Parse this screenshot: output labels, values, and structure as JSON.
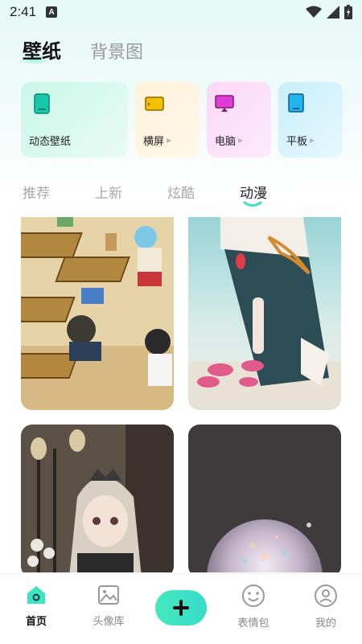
{
  "status_bar": {
    "time": "2:41",
    "notification_badge": "A"
  },
  "top_tabs": [
    {
      "label": "壁纸",
      "active": true
    },
    {
      "label": "背景图",
      "active": false
    }
  ],
  "categories": [
    {
      "label": "动态壁纸",
      "icon": "phone-icon",
      "color": "#17c9a8"
    },
    {
      "label": "横屏",
      "icon": "landscape-icon",
      "color": "#f2c000"
    },
    {
      "label": "电脑",
      "icon": "monitor-icon",
      "color": "#e03cd6"
    },
    {
      "label": "平板",
      "icon": "tablet-icon",
      "color": "#22b4ee"
    }
  ],
  "sub_tabs": [
    {
      "label": "推荐",
      "active": false
    },
    {
      "label": "上新",
      "active": false
    },
    {
      "label": "炫酷",
      "active": false
    },
    {
      "label": "动漫",
      "active": true
    }
  ],
  "wallpapers": [
    {
      "name": "classroom-anime-wallpaper"
    },
    {
      "name": "girl-dress-petals-wallpaper"
    },
    {
      "name": "gothic-doll-girl-wallpaper"
    },
    {
      "name": "crystal-sphere-wallpaper"
    }
  ],
  "bottom_nav": [
    {
      "label": "首页",
      "icon": "home-icon",
      "active": true
    },
    {
      "label": "头像库",
      "icon": "image-icon",
      "active": false
    },
    {
      "label": "表情包",
      "icon": "smile-icon",
      "active": false
    },
    {
      "label": "我的",
      "icon": "profile-icon",
      "active": false
    }
  ],
  "colors": {
    "accent": "#3fe3c3",
    "active_text": "#111111",
    "inactive_text": "#a8a8a8"
  }
}
